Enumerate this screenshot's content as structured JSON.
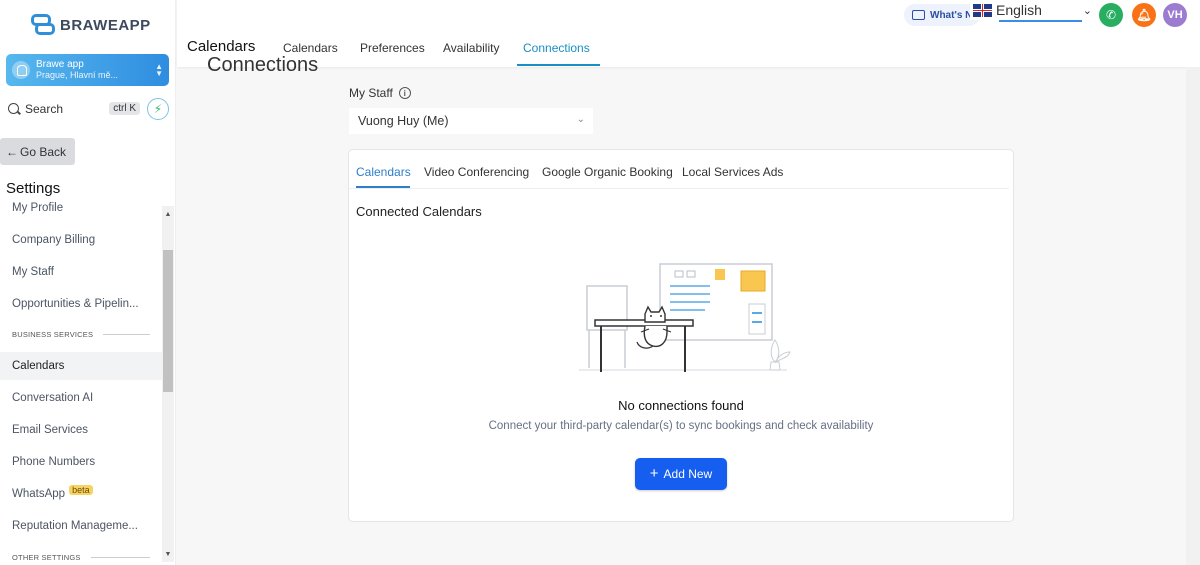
{
  "brand": {
    "name": "BRAWEAPP"
  },
  "account": {
    "name": "Brawe app",
    "location": "Prague, Hlavní mě..."
  },
  "search": {
    "label": "Search",
    "shortcut": "ctrl K"
  },
  "sidebar": {
    "go_back": "Go Back",
    "settings_title": "Settings",
    "items": [
      {
        "label": "My Profile"
      },
      {
        "label": "Company Billing"
      },
      {
        "label": "My Staff"
      },
      {
        "label": "Opportunities & Pipelin..."
      },
      {
        "label": "BUSINESS SERVICES"
      },
      {
        "label": "Calendars"
      },
      {
        "label": "Conversation AI"
      },
      {
        "label": "Email Services"
      },
      {
        "label": "Phone Numbers"
      },
      {
        "label": "WhatsApp",
        "badge": "beta"
      },
      {
        "label": "Reputation Manageme..."
      },
      {
        "label": "OTHER SETTINGS"
      }
    ]
  },
  "header": {
    "title": "Calendars",
    "tabs": [
      {
        "label": "Calendars"
      },
      {
        "label": "Preferences"
      },
      {
        "label": "Availability"
      },
      {
        "label": "Connections",
        "active": true
      }
    ],
    "whats_new": "What's N",
    "language": "English",
    "avatar_initials": "VH"
  },
  "main": {
    "partial_heading": "Connections",
    "staff_label": "My Staff",
    "staff_value": "Vuong Huy (Me)",
    "card_tabs": [
      {
        "label": "Calendars",
        "active": true
      },
      {
        "label": "Video Conferencing"
      },
      {
        "label": "Google Organic Booking"
      },
      {
        "label": "Local Services Ads"
      }
    ],
    "connected_title": "Connected Calendars",
    "empty_title": "No connections found",
    "empty_subtitle": "Connect your third-party calendar(s) to sync bookings and check availability",
    "add_button": "Add New"
  },
  "colors": {
    "accent": "#1a8fc4",
    "primary_button": "#155eef",
    "phone": "#27ae60",
    "bell": "#f97316",
    "avatar": "#9b7cd0",
    "beta_badge": "#f6d364"
  }
}
